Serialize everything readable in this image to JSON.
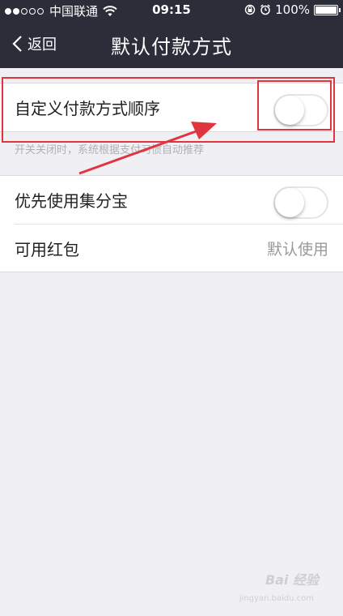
{
  "status_bar": {
    "carrier": "中国联通",
    "time": "09:15",
    "battery": "100%",
    "battery_level": 1.0,
    "signal_bars_filled": 2,
    "signal_bars_total": 5
  },
  "nav": {
    "back_label": "返回",
    "title": "默认付款方式"
  },
  "settings": {
    "custom_order": {
      "label": "自定义付款方式顺序",
      "enabled": false
    },
    "hint": "开关关闭时，系统根据支付习惯自动推荐",
    "priority_jifenbao": {
      "label": "优先使用集分宝",
      "enabled": false
    },
    "red_packet": {
      "label": "可用红包",
      "value": "默认使用"
    }
  },
  "watermark": {
    "text": "Bai 经验",
    "sub": "jingyan.baidu.com"
  },
  "colors": {
    "header_bg": "#2b2d39",
    "page_bg": "#efeff4",
    "annotation_red": "#e0353f"
  }
}
